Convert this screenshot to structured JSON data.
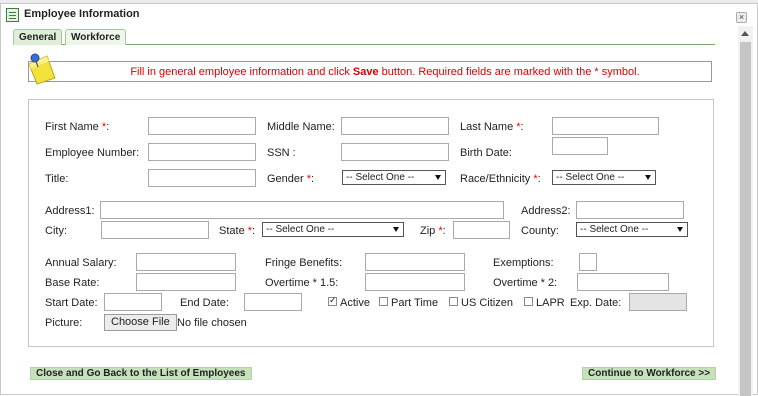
{
  "window": {
    "title": "Employee Information",
    "close_glyph": "×"
  },
  "tabs": [
    {
      "label": "General",
      "active": true
    },
    {
      "label": "Workforce",
      "active": false
    }
  ],
  "notice": {
    "part1": "Fill in general employee information and click ",
    "bold": "Save",
    "part2": " button. Required fields are marked with the * symbol.",
    "icon": "note-pin-icon"
  },
  "required_marker": "*",
  "form": {
    "first_name": {
      "label": "First Name",
      "value": ""
    },
    "middle_name": {
      "label": "Middle Name:",
      "value": ""
    },
    "last_name": {
      "label": "Last Name",
      "value": ""
    },
    "employee_number": {
      "label": "Employee Number:",
      "value": ""
    },
    "ssn": {
      "label": "SSN :",
      "value": ""
    },
    "birth_date": {
      "label": "Birth Date:",
      "value": ""
    },
    "title": {
      "label": "Title:",
      "value": ""
    },
    "gender": {
      "label": "Gender",
      "selected": "-- Select One --"
    },
    "race": {
      "label": "Race/Ethnicity",
      "selected": "-- Select One --"
    },
    "address1": {
      "label": "Address1:",
      "value": ""
    },
    "address2": {
      "label": "Address2:",
      "value": ""
    },
    "city": {
      "label": "City:",
      "value": ""
    },
    "state": {
      "label": "State",
      "selected": "-- Select One --"
    },
    "zip": {
      "label": "Zip",
      "value": ""
    },
    "county": {
      "label": "County:",
      "selected": "-- Select One --"
    },
    "annual_salary": {
      "label": "Annual Salary:",
      "value": ""
    },
    "fringe_benefits": {
      "label": "Fringe Benefits:",
      "value": ""
    },
    "exemptions": {
      "label": "Exemptions:",
      "value": ""
    },
    "base_rate": {
      "label": "Base Rate:",
      "value": ""
    },
    "overtime_15": {
      "label": "Overtime * 1.5:",
      "value": ""
    },
    "overtime_2": {
      "label": "Overtime * 2:",
      "value": ""
    },
    "start_date": {
      "label": "Start Date:",
      "value": ""
    },
    "end_date": {
      "label": "End Date:",
      "value": ""
    },
    "active": {
      "label": "Active",
      "checked": true
    },
    "part_time": {
      "label": "Part Time",
      "checked": false
    },
    "us_citizen": {
      "label": "US Citizen",
      "checked": false
    },
    "lapr": {
      "label": "LAPR",
      "checked": false
    },
    "exp_date": {
      "label": "Exp. Date:",
      "value": ""
    },
    "picture": {
      "label": "Picture:",
      "button": "Choose File",
      "status": "No file chosen"
    }
  },
  "footer": {
    "back_button": "Close and Go Back to the List of Employees",
    "continue_button": "Continue to Workforce >>"
  },
  "colors": {
    "accent_green": "#c6e1ba",
    "required_red": "#e00000",
    "notice_red": "#dd0000"
  }
}
